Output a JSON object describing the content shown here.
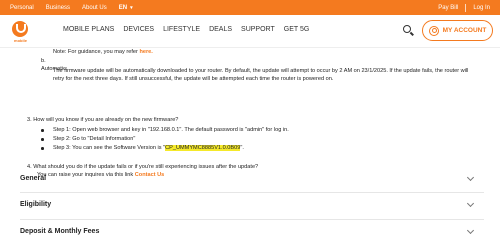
{
  "topbar": {
    "links": [
      "Personal",
      "Business",
      "About Us"
    ],
    "language": "EN",
    "pay_bill": "Pay Bill",
    "login": "Log In"
  },
  "brand": {
    "logo_text": "mobile"
  },
  "nav": {
    "items": [
      "MOBILE PLANS",
      "DEVICES",
      "LIFESTYLE",
      "DEALS",
      "SUPPORT",
      "GET 5G"
    ],
    "account_label": "MY ACCOUNT"
  },
  "content": {
    "note_prefix": "Note: For guidance, you may refer ",
    "note_link": "here.",
    "item_b_label": "b.   Automatic:",
    "item_b_text": "The firmware update will be automatically downloaded to your router. By default, the update will attempt to occur by 2 AM on 23/1/2025. If the update fails, the router will retry for the next three days. If still unsuccessful, the update will be attempted each time the router is powered on.",
    "q3": "3.   How will you know if you are already on the new firmware?",
    "step1": "Step 1: Open web browser and key in \"192.168.0.1\". The default password is \"admin\" for log in.",
    "step2": "Step 2: Go to \"Detail Information\"",
    "step3_prefix": "Step 3: You can see the Software Version is \"",
    "step3_version": "CP_UMMYMC8885V1.0.0B09",
    "step3_suffix": "\".",
    "q4": "4.   What should you do if the update fails or if you're still experiencing issues after the update?",
    "q4_answer_prefix": "You can raise your inquires via this link ",
    "q4_link": "Contact Us"
  },
  "accordions": [
    "General",
    "Eligibility",
    "Deposit & Monthly Fees"
  ],
  "colors": {
    "brand_orange": "#f47a1f",
    "highlight": "#f5e92a"
  }
}
